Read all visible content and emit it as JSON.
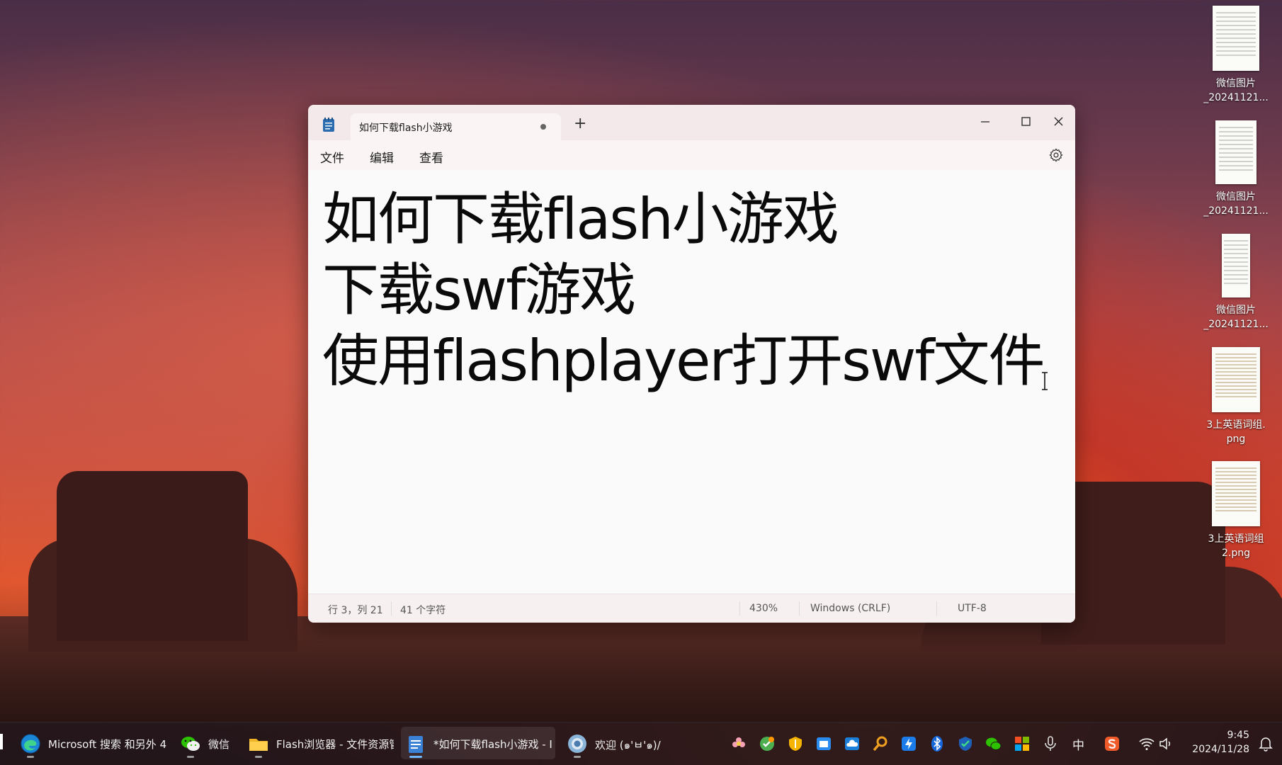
{
  "desktop": {
    "icons": [
      {
        "label_line1": "微信图片",
        "label_line2": "_20241121..."
      },
      {
        "label_line1": "微信图片",
        "label_line2": "_20241121..."
      },
      {
        "label_line1": "微信图片",
        "label_line2": "_20241121..."
      },
      {
        "label_line1": "3上英语词组.",
        "label_line2": "png"
      },
      {
        "label_line1": "3上英语词组",
        "label_line2": "2.png"
      }
    ]
  },
  "notepad": {
    "tab_title": "如何下载flash小游戏",
    "new_tab_symbol": "+",
    "menu": {
      "file": "文件",
      "edit": "编辑",
      "view": "查看"
    },
    "content_lines": [
      "如何下载flash小游戏",
      "下载swf游戏",
      "使用flashplayer打开swf文件"
    ],
    "status": {
      "position": "行 3，列 21",
      "char_count": "41 个字符",
      "zoom": "430%",
      "line_ending": "Windows (CRLF)",
      "encoding": "UTF-8"
    }
  },
  "taskbar": {
    "apps": [
      {
        "label": "Microsoft 搜索 和另外 4",
        "icon": "edge-icon"
      },
      {
        "label": "微信",
        "icon": "wechat-icon"
      },
      {
        "label": "Flash浏览器 - 文件资源管",
        "icon": "folder-icon"
      },
      {
        "label": "*如何下载flash小游戏 - I",
        "icon": "notepad-icon"
      },
      {
        "label": "欢迎 (๑'ㅂ'๑)/",
        "icon": "browser-icon"
      }
    ],
    "ime": "中",
    "time": "9:45",
    "date": "2024/11/28"
  },
  "colors": {
    "accent": "#0067c0",
    "title_bar": "#f4e9ea",
    "taskbar": "#20161a"
  }
}
